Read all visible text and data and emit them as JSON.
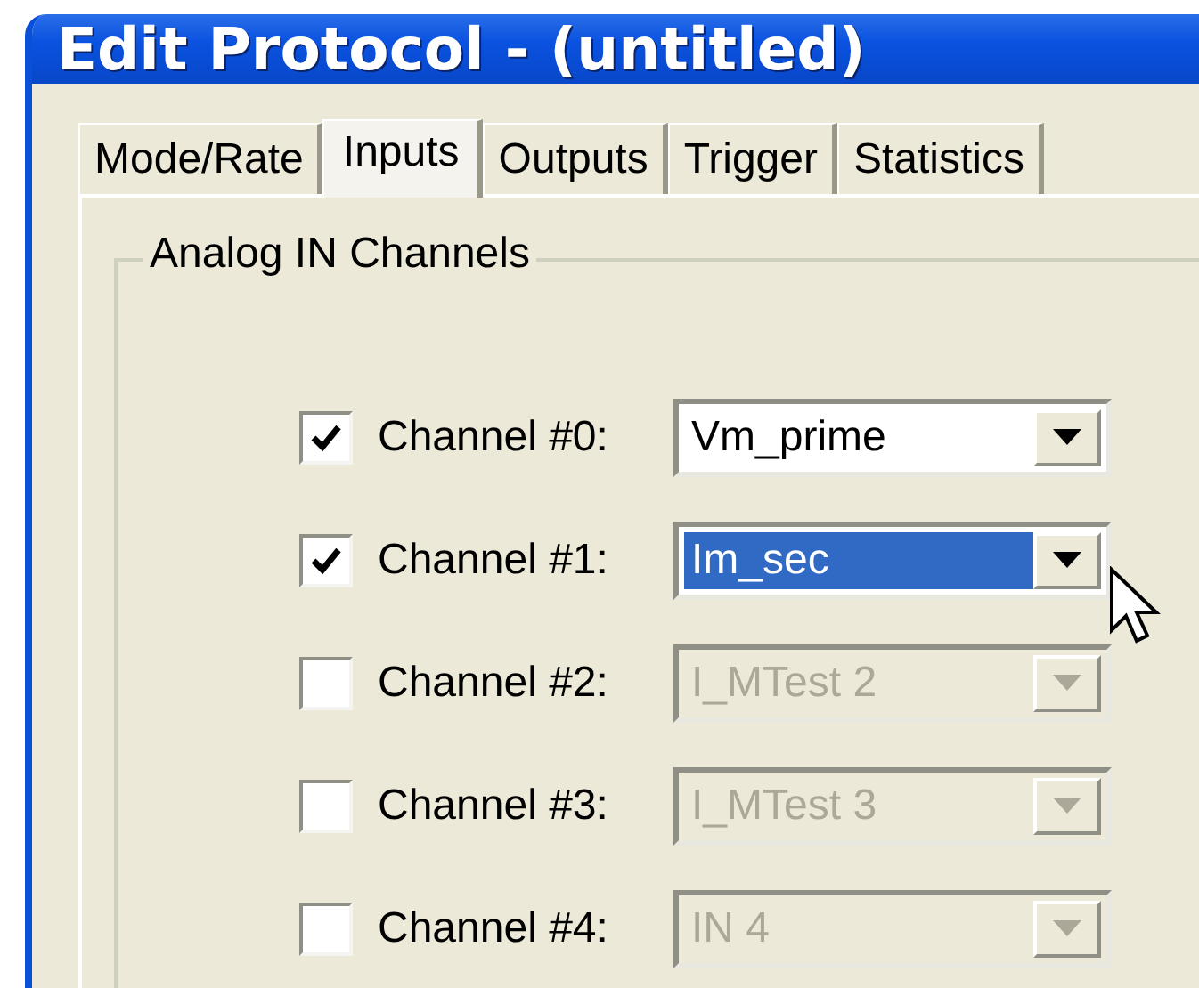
{
  "window": {
    "title": "Edit Protocol - (untitled)"
  },
  "tabs": [
    {
      "label": "Mode/Rate",
      "selected": false
    },
    {
      "label": "Inputs",
      "selected": true
    },
    {
      "label": "Outputs",
      "selected": false
    },
    {
      "label": "Trigger",
      "selected": false
    },
    {
      "label": "Statistics",
      "selected": false
    }
  ],
  "group": {
    "title": "Analog IN Channels"
  },
  "channels": [
    {
      "label": "Channel #0:",
      "checked": true,
      "value": "Vm_prime",
      "selected": false,
      "disabled": false
    },
    {
      "label": "Channel #1:",
      "checked": true,
      "value": "Im_sec",
      "selected": true,
      "disabled": false
    },
    {
      "label": "Channel #2:",
      "checked": false,
      "value": "I_MTest 2",
      "selected": false,
      "disabled": true
    },
    {
      "label": "Channel #3:",
      "checked": false,
      "value": "I_MTest 3",
      "selected": false,
      "disabled": true
    },
    {
      "label": "Channel #4:",
      "checked": false,
      "value": "IN 4",
      "selected": false,
      "disabled": true
    }
  ]
}
